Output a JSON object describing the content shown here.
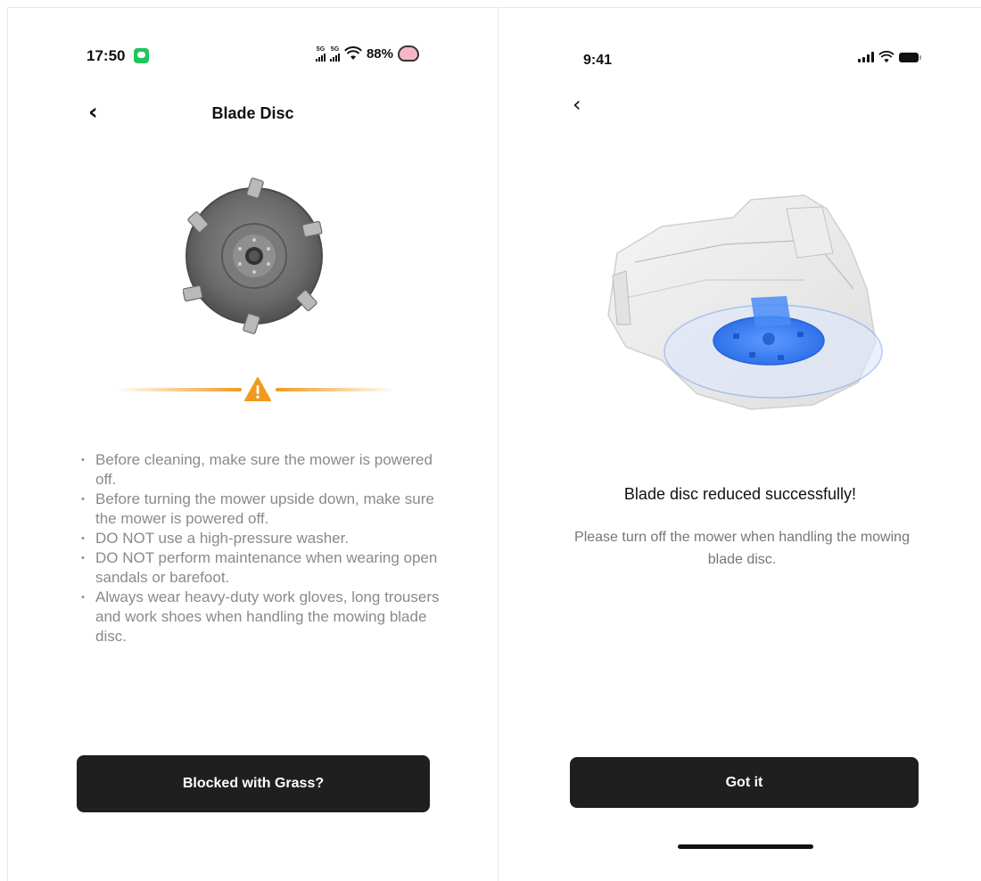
{
  "left_screen": {
    "status_bar": {
      "time": "17:50",
      "network_1": "5G",
      "network_2": "5G",
      "battery": "88%"
    },
    "nav": {
      "title": "Blade Disc"
    },
    "tips": [
      "Before cleaning, make sure the mower is powered off.",
      "Before turning the mower upside down, make sure the mower is powered off.",
      "DO NOT use a high-pressure washer.",
      "DO NOT perform maintenance when wearing open sandals or barefoot.",
      "Always wear heavy-duty work gloves, long trousers and work shoes when handling the mowing blade disc."
    ],
    "button_label": "Blocked with Grass?",
    "colors": {
      "warning": "#f19a1f",
      "button_bg": "#1f1f1f",
      "status_app_badge": "#1fc55a"
    }
  },
  "right_screen": {
    "status_bar": {
      "time": "9:41"
    },
    "title": "Blade disc reduced successfully!",
    "description": "Please turn off the mower when handling the mowing blade disc.",
    "button_label": "Got it",
    "colors": {
      "highlight_blue": "#3d86f5",
      "button_bg": "#1f1f1f"
    }
  }
}
